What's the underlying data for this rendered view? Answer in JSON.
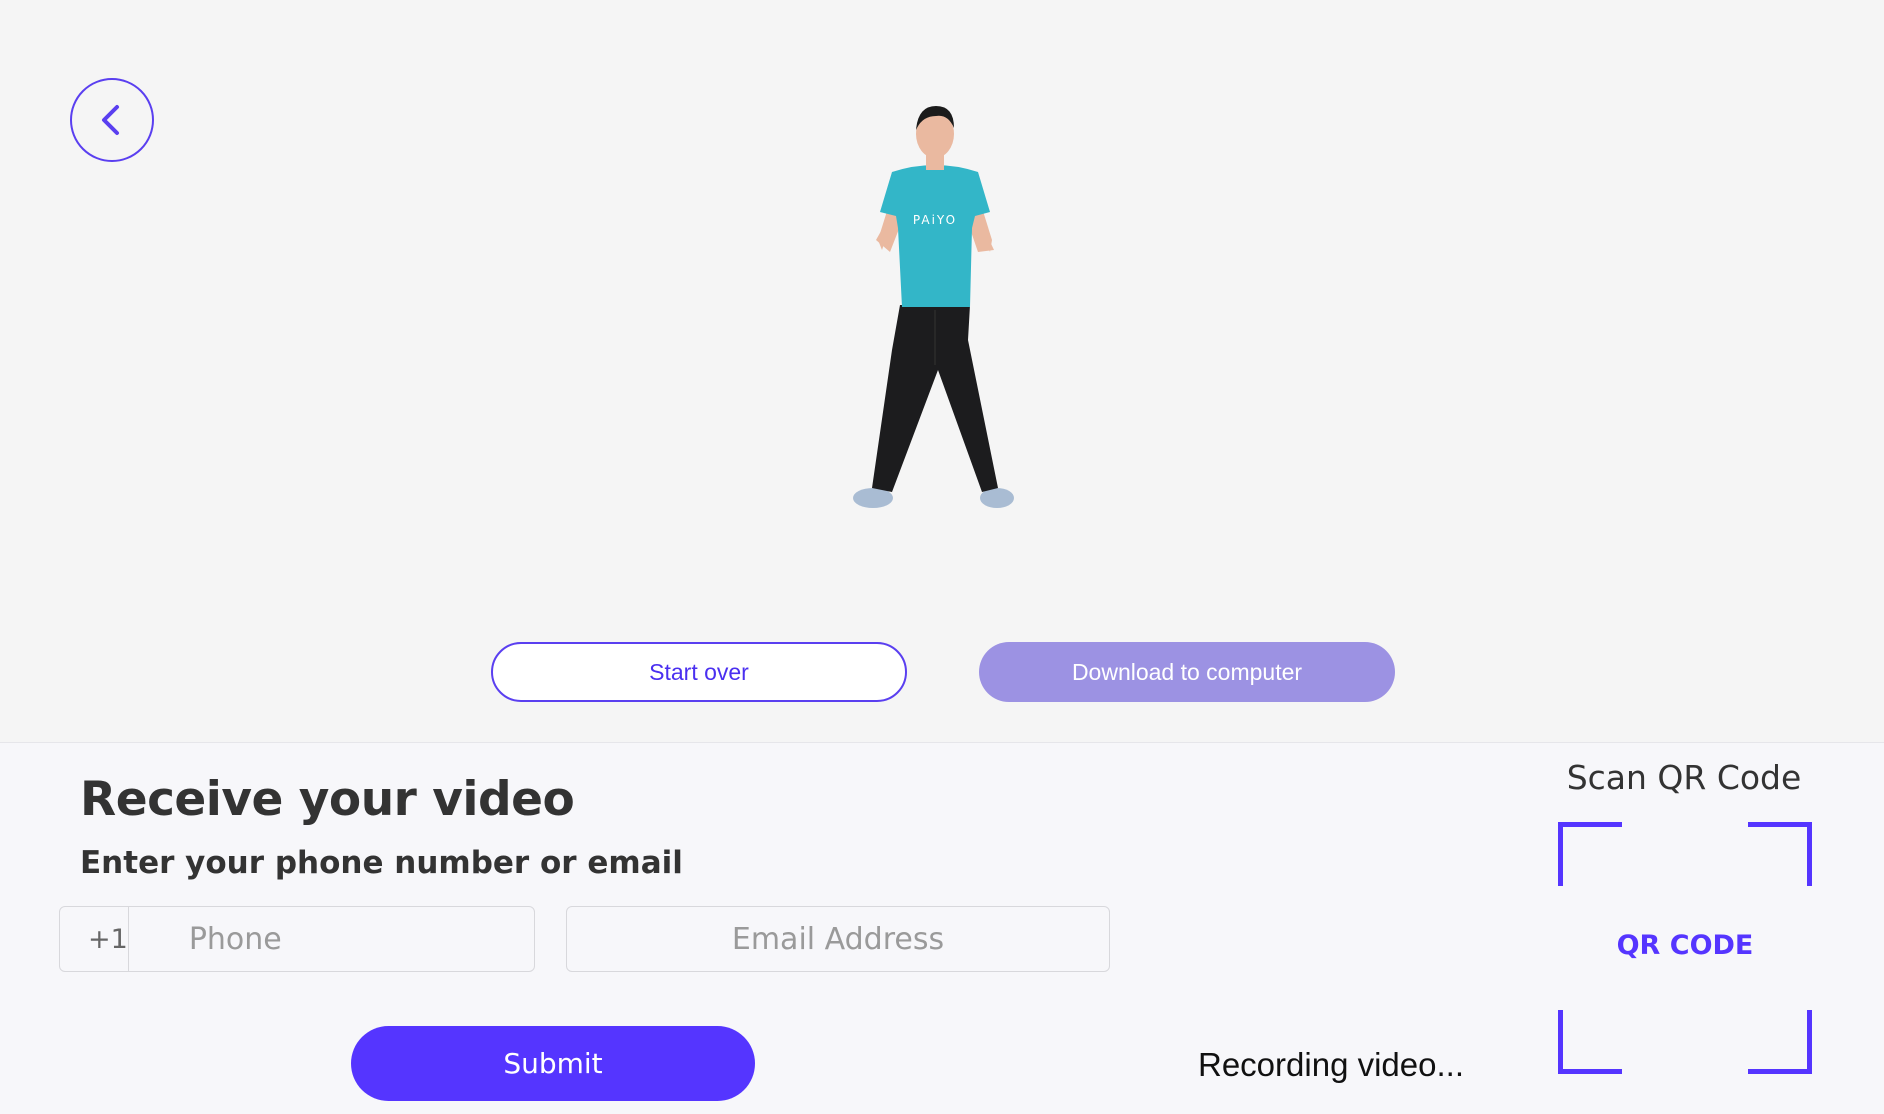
{
  "nav": {
    "back_icon": "chevron-left-icon",
    "accent_color": "#5a3ff0"
  },
  "avatar": {
    "shirt_text": "PAiYO"
  },
  "actions": {
    "start_over_label": "Start over",
    "download_label": "Download to computer"
  },
  "receive": {
    "title": "Receive your video",
    "subtitle": "Enter your phone number or email",
    "country_code": "+1",
    "phone_placeholder": "Phone",
    "email_placeholder": "Email Address",
    "submit_label": "Submit"
  },
  "status": {
    "recording_text": "Recording video..."
  },
  "qr": {
    "heading": "Scan QR Code",
    "label": "QR CODE",
    "color": "#5535ff"
  }
}
